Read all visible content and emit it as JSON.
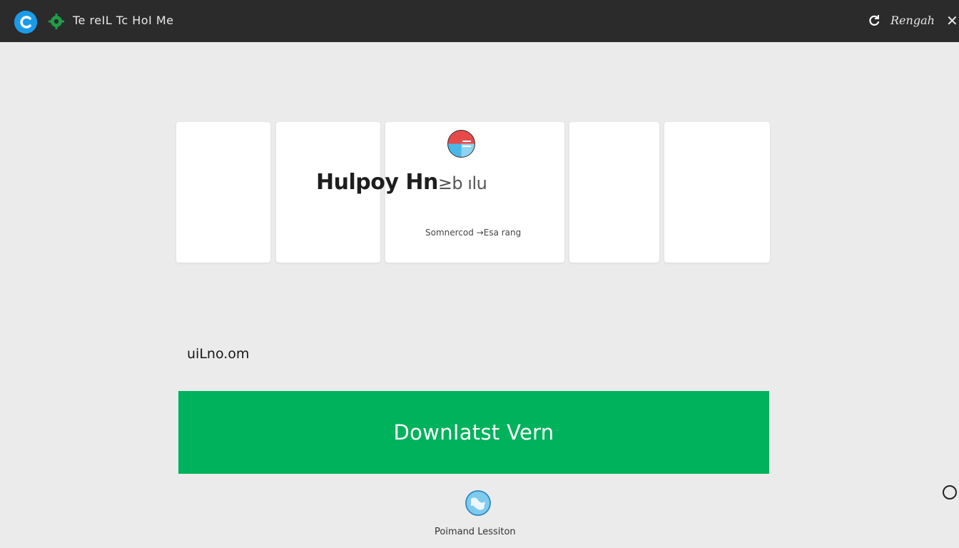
{
  "header": {
    "title": "Te reIL Tc HoI Me",
    "account_label": "Rengah",
    "close_glyph": "✕",
    "icons": [
      "app-logo-icon",
      "gear-icon",
      "refresh-icon",
      "close-icon"
    ]
  },
  "hero": {
    "title_bold": "Hulpoy Hn",
    "title_faint": "≥b ılu",
    "subtitle": "Somnercod →Esa rang"
  },
  "domain_label": "uiLno.om",
  "download_button": {
    "label": "DownIatst Vern"
  },
  "footer": {
    "label": "Poimand Lessiton"
  },
  "colors": {
    "topbar": "#2b2b2b",
    "page_bg": "#ebebeb",
    "accent_green": "#00b25b",
    "logo_blue": "#1a9be8"
  }
}
